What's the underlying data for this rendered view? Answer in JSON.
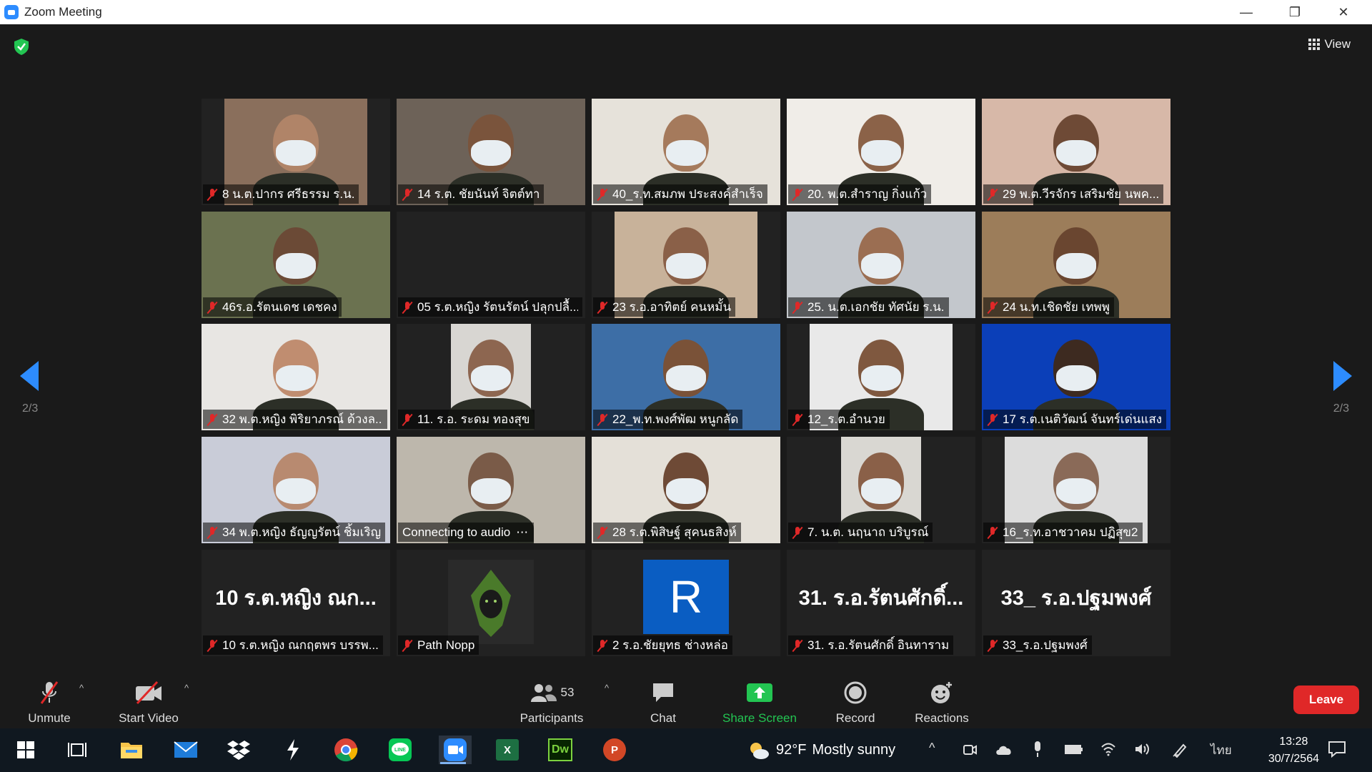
{
  "window": {
    "title": "Zoom Meeting",
    "controls": {
      "minimize": "—",
      "restore": "❐",
      "close": "✕"
    }
  },
  "header": {
    "view_label": "View"
  },
  "pager": {
    "left": "2/3",
    "right": "2/3"
  },
  "tiles": [
    {
      "name": "8 น.ต.ปากร ศรีธรรม ร.น.",
      "type": "video"
    },
    {
      "name": "14 ร.ต. ชัยนันท์ จิตต์ทา",
      "type": "video"
    },
    {
      "name": "40_ร.ท.สมภพ ประสงค์สำเร็จ",
      "type": "video"
    },
    {
      "name": "20. พ.ต.สำราญ  กิ่งแก้ว",
      "type": "video"
    },
    {
      "name": "29 พ.ต.วีรจักร  เสริมชัย นพค...",
      "type": "video"
    },
    {
      "name": "46ร.อ.รัตนเดช เดชคง",
      "type": "video"
    },
    {
      "name": "05 ร.ต.หญิง รัตนรัตน์ ปลุกปลื้...",
      "type": "blank"
    },
    {
      "name": "23 ร.อ.อาทิตย์ คนหมั้น",
      "type": "video"
    },
    {
      "name": "25. น.ต.เอกชัย ทัศนัย ร.น.",
      "type": "video"
    },
    {
      "name": "24 น.ท.เชิดชัย เทพพู",
      "type": "video"
    },
    {
      "name": "32 พ.ต.หญิง พิริยาภรณ์ ด้วงล...",
      "type": "video"
    },
    {
      "name": "11. ร.อ. ระดม ทองสุข",
      "type": "video"
    },
    {
      "name": "22_พ.ท.พงศ์พัฒ หนูกลัด",
      "type": "video"
    },
    {
      "name": "12_ร.ต.อำนวย",
      "type": "video"
    },
    {
      "name": "17 ร.ต.เนติวัฒน์ จันทร์เด่นแสง",
      "type": "video"
    },
    {
      "name": "34 พ.ต.หญิง ธัญญรัตน์ ชิ้มเริญ",
      "type": "video"
    },
    {
      "name": "Connecting to audio",
      "type": "video",
      "connecting": true
    },
    {
      "name": "28 ร.ต.พิสิษฐ์ สุคนธสิงห์",
      "type": "video"
    },
    {
      "name": "7. น.ต. นฤนาถ   บริบูรณ์",
      "type": "video"
    },
    {
      "name": "16_ร.ท.อาชวาคม ปฏิสุข2",
      "type": "video"
    },
    {
      "name": "10 ร.ต.หญิง ณกฤตพร บรรพ...",
      "type": "text",
      "big": "10 ร.ต.หญิง ณก..."
    },
    {
      "name": "Path Nopp",
      "type": "picture"
    },
    {
      "name": "2 ร.อ.ชัยยุทธ  ช่างหล่อ",
      "type": "letter",
      "letter": "R"
    },
    {
      "name": "31. ร.อ.รัตนศักดิ์  อินทาราม",
      "type": "text",
      "big": "31. ร.อ.รัตนศักดิ์..."
    },
    {
      "name": "33_ร.อ.ปฐมพงศ์",
      "type": "text",
      "big": "33_ ร.อ.ปฐมพงศ์"
    }
  ],
  "toolbar": {
    "unmute": "Unmute",
    "start_video": "Start Video",
    "participants": "Participants",
    "participants_count": "53",
    "chat": "Chat",
    "share_screen": "Share Screen",
    "record": "Record",
    "reactions": "Reactions",
    "leave": "Leave",
    "caret": "^"
  },
  "taskbar": {
    "apps": [
      "windows-start",
      "task-view",
      "file-explorer",
      "mail",
      "dropbox",
      "bolt-app",
      "chrome",
      "line",
      "zoom",
      "excel",
      "dreamweaver",
      "powerpoint"
    ],
    "excel_letter": "X",
    "dw_letters": "Dw",
    "ppt_letter": "P",
    "weather_temp": "92°F",
    "weather_text": "Mostly sunny",
    "language": "ไทย",
    "time": "13:28",
    "date": "30/7/2564"
  },
  "colors": {
    "accent": "#2d8cff",
    "leave": "#e02828",
    "share": "#23c552",
    "muted": "#e02828",
    "background": "#1a1a1a"
  }
}
